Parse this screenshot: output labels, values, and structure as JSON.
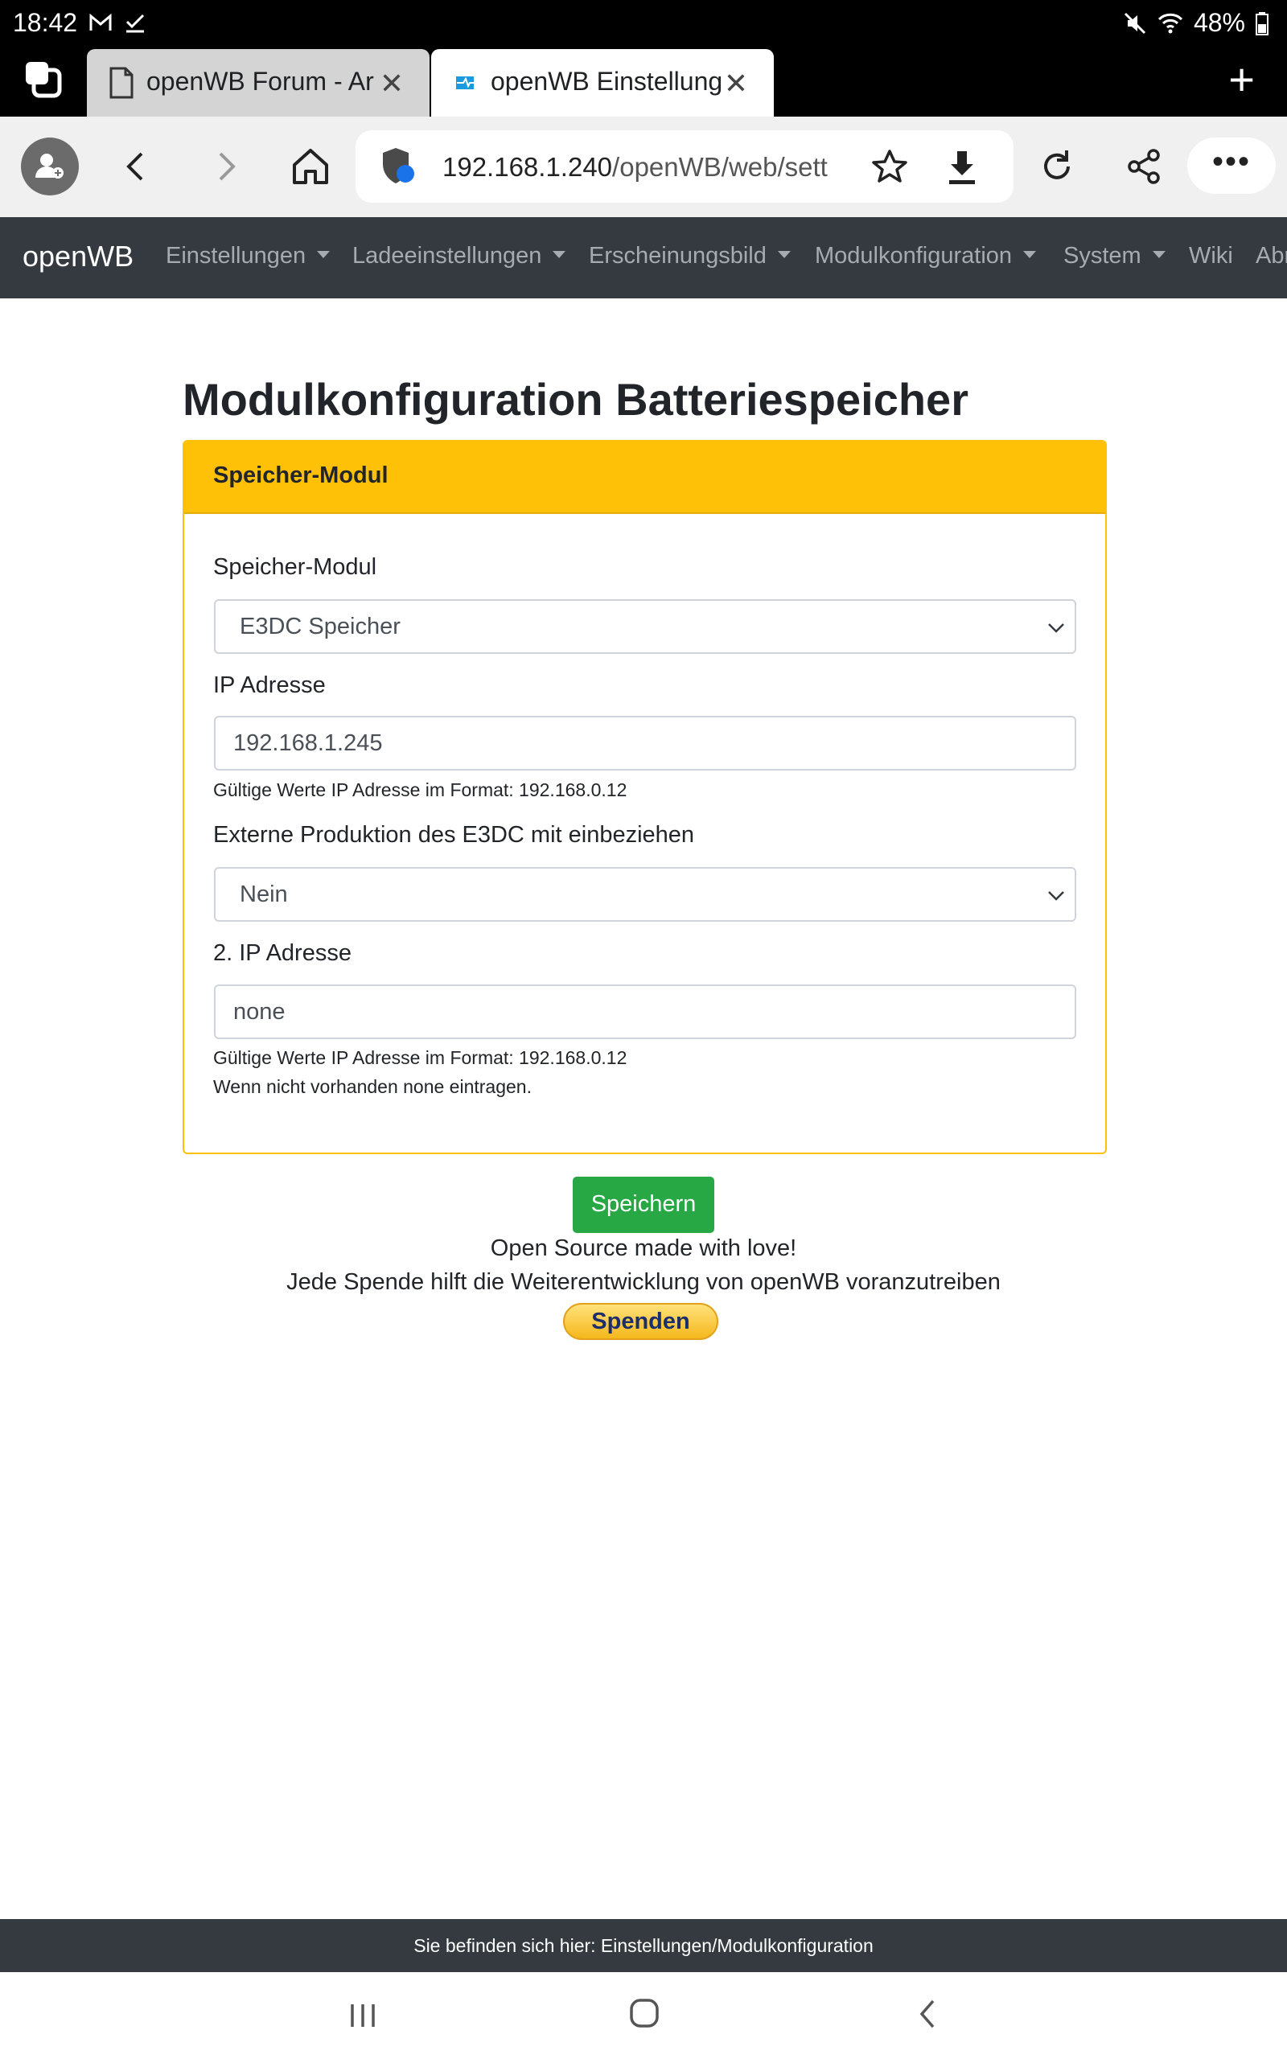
{
  "statusbar": {
    "time": "18:42",
    "battery": "48%"
  },
  "tabs": [
    {
      "title": "openWB Forum - Ar",
      "close": "✕"
    },
    {
      "title": "openWB Einstellung",
      "close": "✕"
    }
  ],
  "newtab": "+",
  "address": {
    "url_host": "192.168.1.240",
    "url_path": "/openWB/web/sett",
    "more": "•••"
  },
  "navbar": {
    "brand": "openWB",
    "items": [
      {
        "label": "Einstellungen",
        "dropdown": true
      },
      {
        "label": "Ladeeinstellungen",
        "dropdown": true
      },
      {
        "label": "Erscheinungsbild",
        "dropdown": true
      },
      {
        "label": "Modulkonfiguration",
        "dropdown": true
      },
      {
        "label": "System",
        "dropdown": true
      },
      {
        "label": "Wiki",
        "dropdown": false
      },
      {
        "label": "Abr",
        "dropdown": false
      }
    ]
  },
  "page": {
    "heading": "Modulkonfiguration Batteriespeicher",
    "card_header": "Speicher-Modul",
    "fields": {
      "module_label": "Speicher-Modul",
      "module_value": "E3DC Speicher",
      "ip_label": "IP Adresse",
      "ip_value": "192.168.1.245",
      "ip_help": "Gültige Werte IP Adresse im Format: 192.168.0.12",
      "extern_label": "Externe Produktion des E3DC mit einbeziehen",
      "extern_value": "Nein",
      "ip2_label": "2. IP Adresse",
      "ip2_value": "none",
      "ip2_help": "Gültige Werte IP Adresse im Format: 192.168.0.12",
      "ip2_help2": "Wenn nicht vorhanden none eintragen."
    },
    "save_label": "Speichern",
    "love_text": "Open Source made with love!",
    "donate_text": "Jede Spende hilft die Weiterentwicklung von openWB voranzutreiben",
    "donate_button": "Spenden"
  },
  "footer": {
    "location": "Sie befinden sich hier: Einstellungen/Modulkonfiguration"
  },
  "colors": {
    "navbar_bg": "#343a40",
    "card_accent": "#ffc107",
    "save_green": "#28a745"
  }
}
